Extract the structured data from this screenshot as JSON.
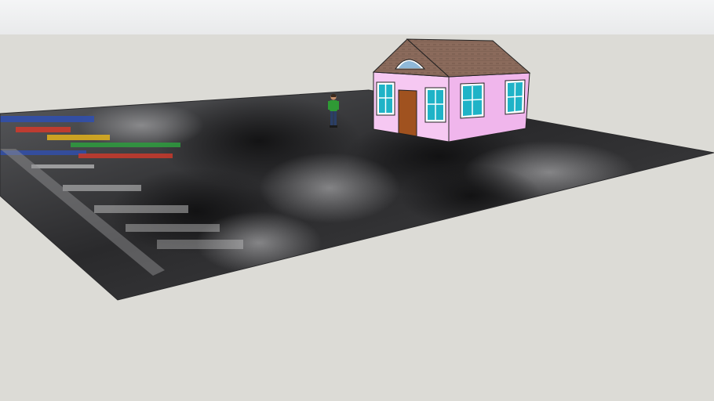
{
  "scene": {
    "colors": {
      "sky": "#eeeff0",
      "ground": "#dcdbd6",
      "terrain": "#3e3e40",
      "wall_front": "#f6c8f2",
      "wall_side": "#f0b6ec",
      "roof": "#8a6a5a",
      "door": "#a0521f",
      "window_glass": "#1fb3c7",
      "window_frame": "#ffffff",
      "person_shirt": "#2f9a35",
      "person_pants": "#2b3f66"
    },
    "icons": {
      "person": "person-figure-icon",
      "house": "house-model-icon"
    }
  }
}
